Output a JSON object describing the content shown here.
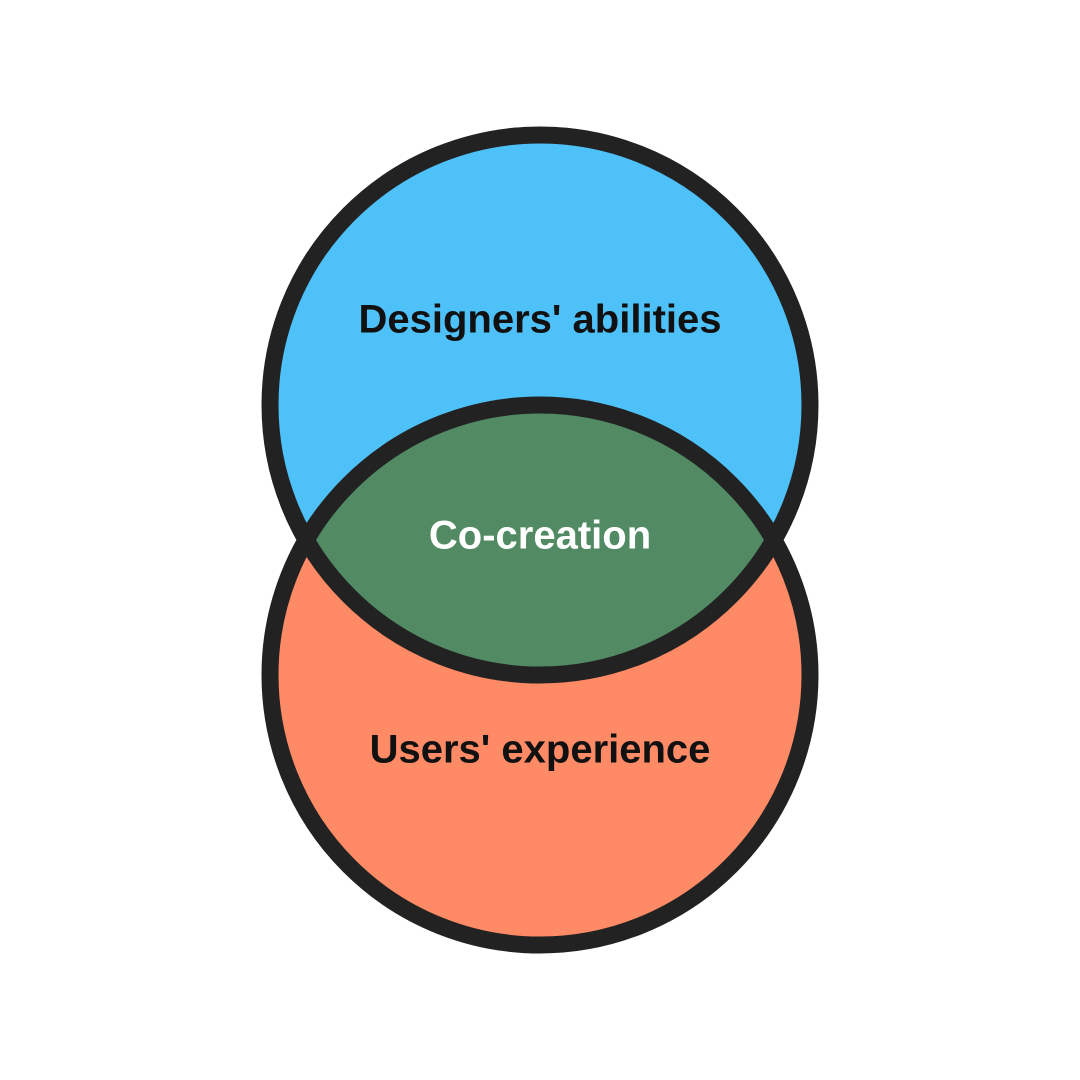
{
  "diagram": {
    "type": "venn",
    "sets": [
      {
        "id": "top",
        "label": "Designers' abilities",
        "fill": "#4fc1f9"
      },
      {
        "id": "bottom",
        "label": "Users' experience",
        "fill": "#ff8a66"
      }
    ],
    "intersection": {
      "label": "Co-creation",
      "fill": "#518a63",
      "label_color": "#ffffff"
    },
    "outline_color": "#222222",
    "label_color": "#111111",
    "background": "#ffffff"
  }
}
